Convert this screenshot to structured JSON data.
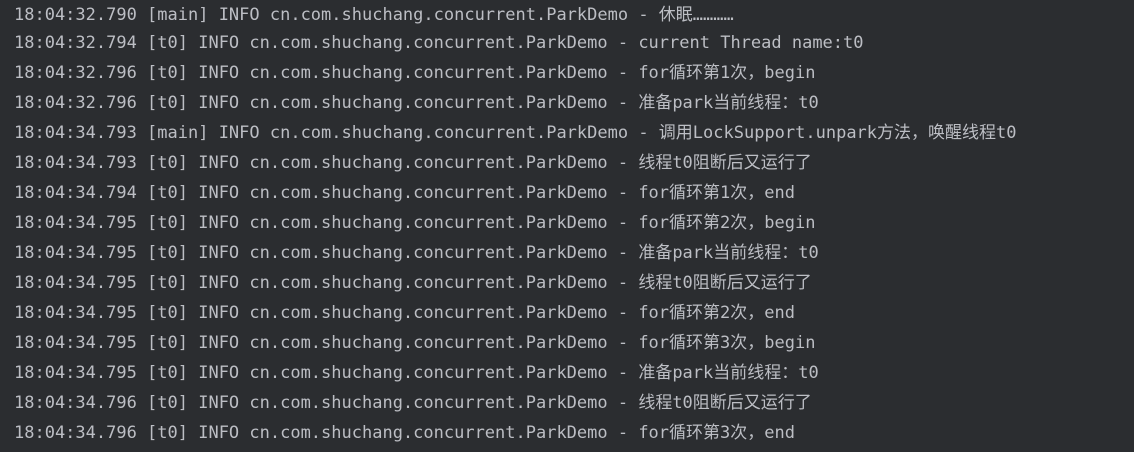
{
  "console": {
    "text_color": "#bcbec4",
    "background_color": "#2b2d30",
    "lines": [
      "18:04:32.790 [main] INFO cn.com.shuchang.concurrent.ParkDemo - 休眠…………",
      "18:04:32.794 [t0] INFO cn.com.shuchang.concurrent.ParkDemo - current Thread name:t0",
      "18:04:32.796 [t0] INFO cn.com.shuchang.concurrent.ParkDemo - for循环第1次，begin",
      "18:04:32.796 [t0] INFO cn.com.shuchang.concurrent.ParkDemo - 准备park当前线程：t0",
      "18:04:34.793 [main] INFO cn.com.shuchang.concurrent.ParkDemo - 调用LockSupport.unpark方法，唤醒线程t0",
      "18:04:34.793 [t0] INFO cn.com.shuchang.concurrent.ParkDemo - 线程t0阻断后又运行了",
      "18:04:34.794 [t0] INFO cn.com.shuchang.concurrent.ParkDemo - for循环第1次，end",
      "18:04:34.795 [t0] INFO cn.com.shuchang.concurrent.ParkDemo - for循环第2次，begin",
      "18:04:34.795 [t0] INFO cn.com.shuchang.concurrent.ParkDemo - 准备park当前线程：t0",
      "18:04:34.795 [t0] INFO cn.com.shuchang.concurrent.ParkDemo - 线程t0阻断后又运行了",
      "18:04:34.795 [t0] INFO cn.com.shuchang.concurrent.ParkDemo - for循环第2次，end",
      "18:04:34.795 [t0] INFO cn.com.shuchang.concurrent.ParkDemo - for循环第3次，begin",
      "18:04:34.795 [t0] INFO cn.com.shuchang.concurrent.ParkDemo - 准备park当前线程：t0",
      "18:04:34.796 [t0] INFO cn.com.shuchang.concurrent.ParkDemo - 线程t0阻断后又运行了",
      "18:04:34.796 [t0] INFO cn.com.shuchang.concurrent.ParkDemo - for循环第3次，end"
    ]
  }
}
